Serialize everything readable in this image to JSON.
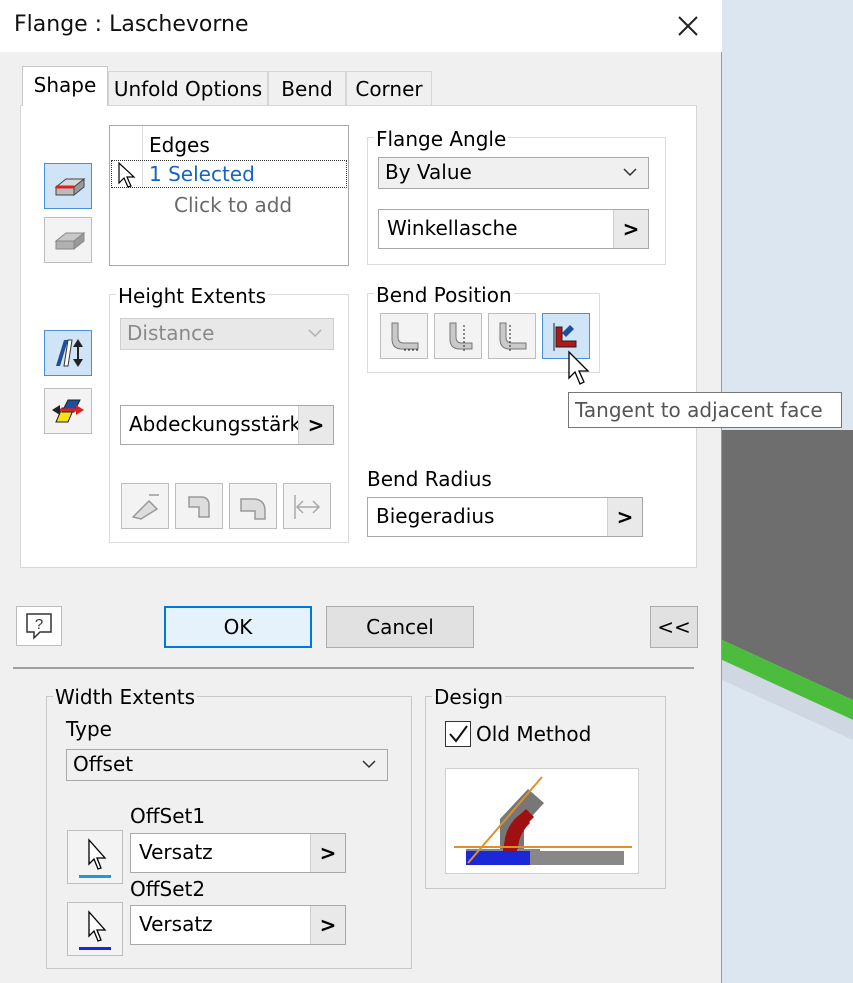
{
  "window": {
    "title": "Flange : Laschevorne"
  },
  "tabs": [
    {
      "label": "Shape"
    },
    {
      "label": "Unfold Options"
    },
    {
      "label": "Bend"
    },
    {
      "label": "Corner"
    }
  ],
  "edges": {
    "header": "Edges",
    "selected": "1 Selected",
    "add_hint": "Click to add"
  },
  "flange_angle": {
    "label": "Flange Angle",
    "mode": "By Value",
    "value": "Winkellasche"
  },
  "height_extents": {
    "label": "Height Extents",
    "mode": "Distance",
    "value": "Abdeckungsstärke"
  },
  "bend_position": {
    "label": "Bend Position",
    "tooltip": "Tangent to adjacent face"
  },
  "bend_radius": {
    "label": "Bend Radius",
    "value": "Biegeradius"
  },
  "buttons": {
    "ok": "OK",
    "cancel": "Cancel",
    "collapse": "<<",
    "arrow": ">"
  },
  "width_extents": {
    "label": "Width Extents",
    "type_label": "Type",
    "type_value": "Offset",
    "offset1_label": "OffSet1",
    "offset1_value": "Versatz",
    "offset2_label": "OffSet2",
    "offset2_value": "Versatz"
  },
  "design": {
    "label": "Design",
    "old_method_label": "Old Method",
    "old_method_checked": true
  },
  "colors": {
    "accent": "#0078d7",
    "link_text": "#1565c0",
    "bend_red": "#a01010",
    "face_blue": "#1a28d8"
  }
}
